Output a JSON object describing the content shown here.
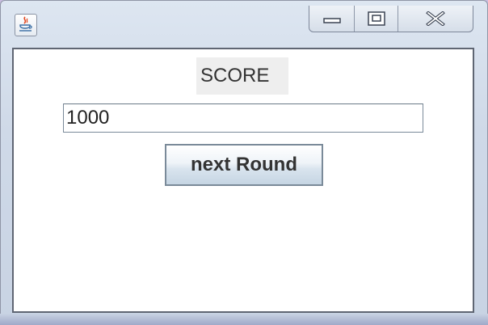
{
  "window": {
    "app_icon": "java-cup-icon",
    "controls": {
      "minimize": "minimize-icon",
      "maximize": "maximize-icon",
      "close": "close-icon"
    }
  },
  "main": {
    "score_label": "SCORE",
    "score_value": "1000",
    "next_round_label": "next Round"
  },
  "colors": {
    "content_background": "#ffffff",
    "label_background": "#eeeeee",
    "frame_accent": "#cfd9e8"
  }
}
